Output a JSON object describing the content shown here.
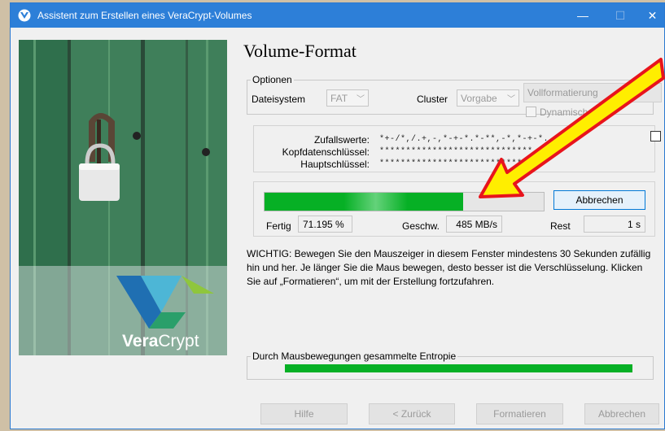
{
  "window": {
    "title": "Assistent zum Erstellen eines VeraCrypt-Volumes",
    "minimize_glyph": "—",
    "maximize_glyph": "☐",
    "close_glyph": "✕"
  },
  "brand": {
    "bold": "Vera",
    "light": "Crypt"
  },
  "page": {
    "heading": "Volume-Format"
  },
  "options": {
    "legend": "Optionen",
    "filesystem_label": "Dateisystem",
    "filesystem_value": "FAT",
    "cluster_label": "Cluster",
    "cluster_value": "Vorgabe",
    "full_format_label": "Vollformatierung",
    "dynamic_label": "Dynamisch"
  },
  "keys": {
    "random_label": "Zufallswerte:",
    "random_value": "*+-/*,/.+,-,*-+-*.*-**,-*,*-+-*...",
    "header_label": "Kopfdatenschlüssel:",
    "header_value": "*****************************",
    "master_label": "Hauptschlüssel:",
    "master_value": "*****************************"
  },
  "progress": {
    "percent": 71.195,
    "abort_label": "Abbrechen",
    "done_label": "Fertig",
    "done_value": "71.195 %",
    "speed_label": "Geschw.",
    "speed_value": "485 MB/s",
    "remaining_label": "Rest",
    "remaining_value": "1 s"
  },
  "info_text": "WICHTIG: Bewegen Sie den Mauszeiger in diesem Fenster mindestens 30 Sekunden zufällig hin und her. Je länger Sie die Maus bewegen, desto besser ist die Verschlüsselung. Klicken Sie auf „Formatieren“, um mit der Erstellung fortzufahren.",
  "entropy": {
    "legend": "Durch Mausbewegungen gesammelte Entropie"
  },
  "footer": {
    "help": "Hilfe",
    "back": "< Zurück",
    "format": "Formatieren",
    "cancel": "Abbrechen"
  },
  "colors": {
    "titlebar": "#2d7fd8",
    "progress_green": "#06b025",
    "arrow_fill": "#ffee00",
    "arrow_outline": "#e8141c"
  },
  "icons": [
    "veracrypt-logo-icon",
    "padlock-image",
    "chevron-down-icon",
    "annotation-arrow"
  ]
}
